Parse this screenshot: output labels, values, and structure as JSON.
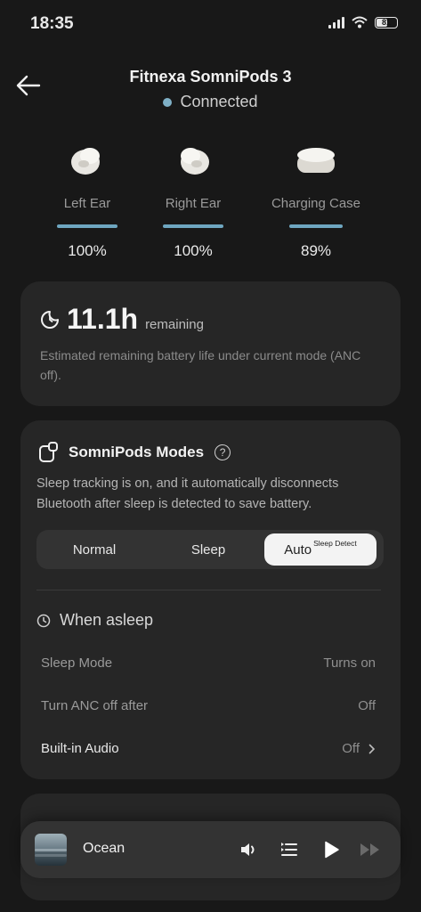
{
  "status_bar": {
    "time": "18:35",
    "battery": "81"
  },
  "header": {
    "title": "Fitnexa SomniPods 3",
    "status": "Connected"
  },
  "devices": [
    {
      "label": "Left Ear",
      "percent": "100%"
    },
    {
      "label": "Right Ear",
      "percent": "100%"
    },
    {
      "label": "Charging Case",
      "percent": "89%"
    }
  ],
  "battery_card": {
    "hours": "11.1h",
    "remaining": "remaining",
    "description": "Estimated remaining battery life under current mode (ANC off)."
  },
  "modes_card": {
    "title": "SomniPods Modes",
    "help": "?",
    "description": "Sleep tracking is on, and it automatically disconnects Bluetooth after sleep is detected to save battery.",
    "options": [
      {
        "label": "Normal"
      },
      {
        "label": "Sleep"
      },
      {
        "label": "Auto",
        "sup": "Sleep Detect"
      }
    ],
    "selected": "Auto",
    "when_asleep_title": "When asleep",
    "rows": [
      {
        "key": "Sleep Mode",
        "value": "Turns on"
      },
      {
        "key": "Turn ANC off after",
        "value": "Off"
      },
      {
        "key": "Built-in Audio",
        "value": "Off"
      }
    ]
  },
  "player": {
    "track": "Ocean"
  },
  "colors": {
    "accent": "#6ea6c0",
    "background": "#181818",
    "card": "#262626"
  }
}
